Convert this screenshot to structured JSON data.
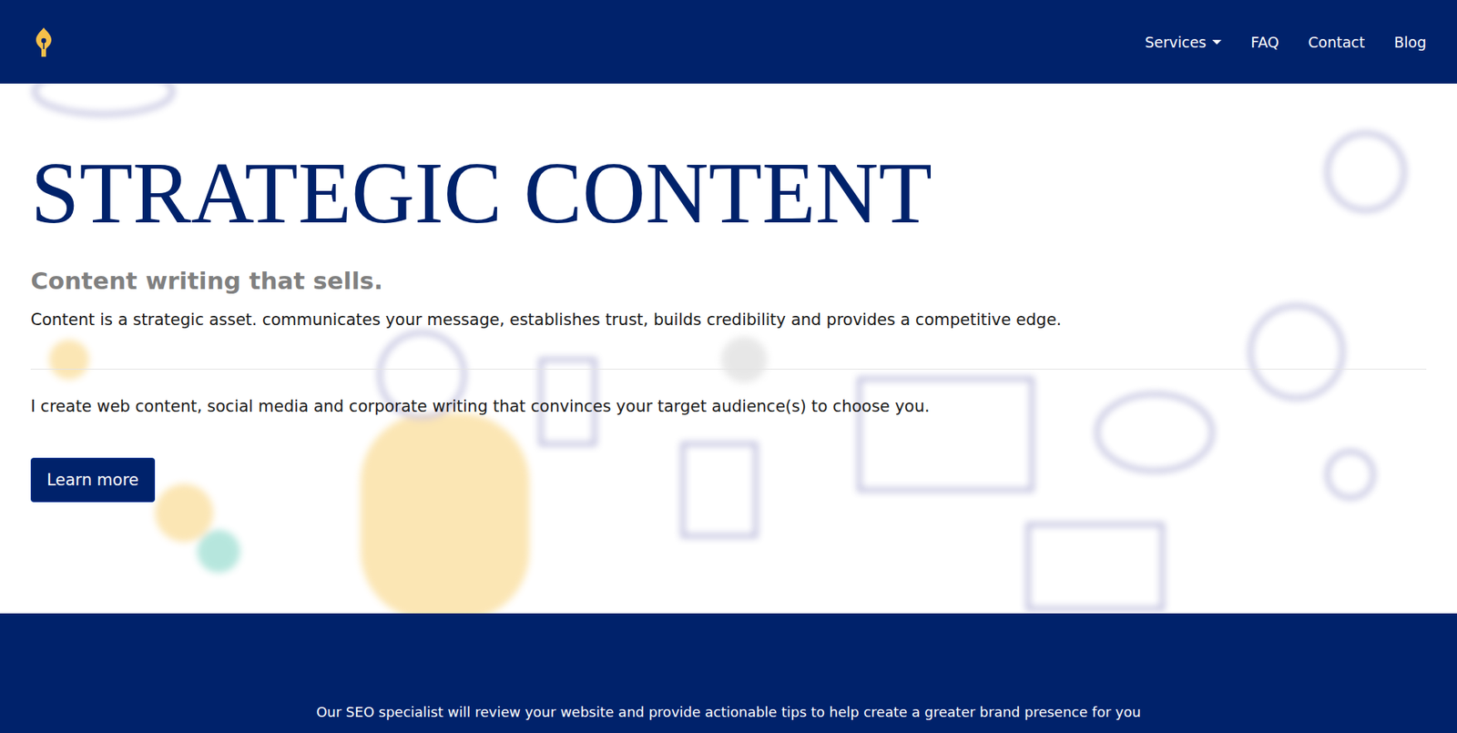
{
  "nav": {
    "items": [
      {
        "label": "Services",
        "dropdown": true
      },
      {
        "label": "FAQ",
        "dropdown": false
      },
      {
        "label": "Contact",
        "dropdown": false
      },
      {
        "label": "Blog",
        "dropdown": false
      }
    ]
  },
  "hero": {
    "title": "STRATEGIC CONTENT",
    "subtitle": "Content writing that sells.",
    "intro": "Content is a strategic asset. communicates your message, establishes trust, builds credibility and provides a competitive edge.",
    "pitch": "I create web content, social media and corporate writing that convinces your target audience(s) to choose you.",
    "button": "Learn more"
  },
  "banner": {
    "text": "Our SEO specialist will review your website and provide actionable tips to help create a greater brand presence for you"
  }
}
